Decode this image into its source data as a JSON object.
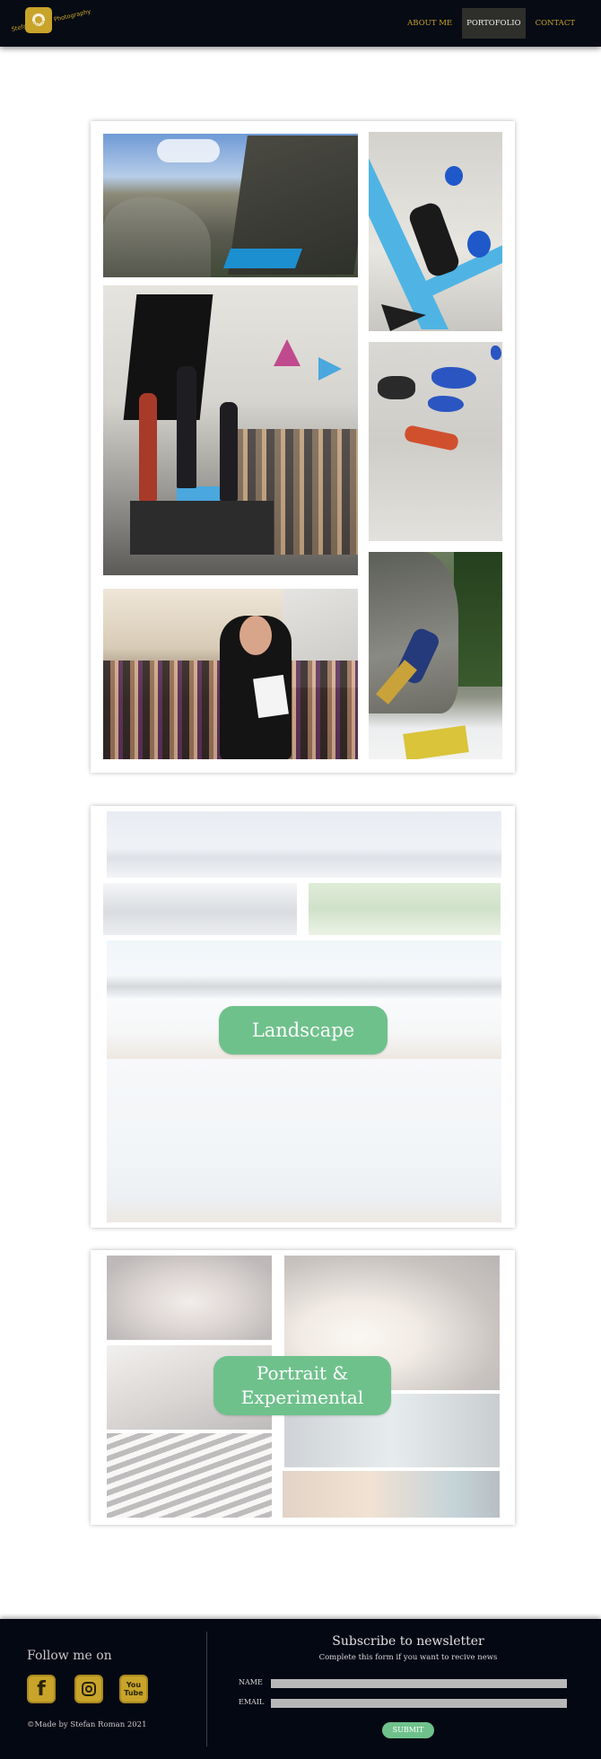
{
  "header": {
    "logo_text": "Stefan Roman Photography",
    "nav": [
      {
        "label": "ABOUT ME",
        "active": false
      },
      {
        "label": "PORTOFOLIO",
        "active": true
      },
      {
        "label": "CONTACT",
        "active": false
      }
    ]
  },
  "galleries": {
    "landscape_label": "Landscape",
    "portrait_label_line1": "Portrait &",
    "portrait_label_line2": "Experimental"
  },
  "footer": {
    "follow_label": "Follow me on",
    "social": [
      {
        "name": "facebook",
        "glyph": "f"
      },
      {
        "name": "instagram",
        "glyph": ""
      },
      {
        "name": "youtube",
        "glyph_line1": "You",
        "glyph_line2": "Tube"
      }
    ],
    "copyright": "©Made by Stefan Roman  2021",
    "newsletter": {
      "title": "Subscribe to newsletter",
      "subtitle": "Complete this form  if you want to recive news",
      "name_label": "NAME",
      "email_label": "EMAIL",
      "submit_label": "SUBMIT"
    }
  },
  "colors": {
    "header_bg": "#070b14",
    "accent_gold": "#c8a42a",
    "button_green": "#6fc18c",
    "footer_bg": "#040813"
  }
}
